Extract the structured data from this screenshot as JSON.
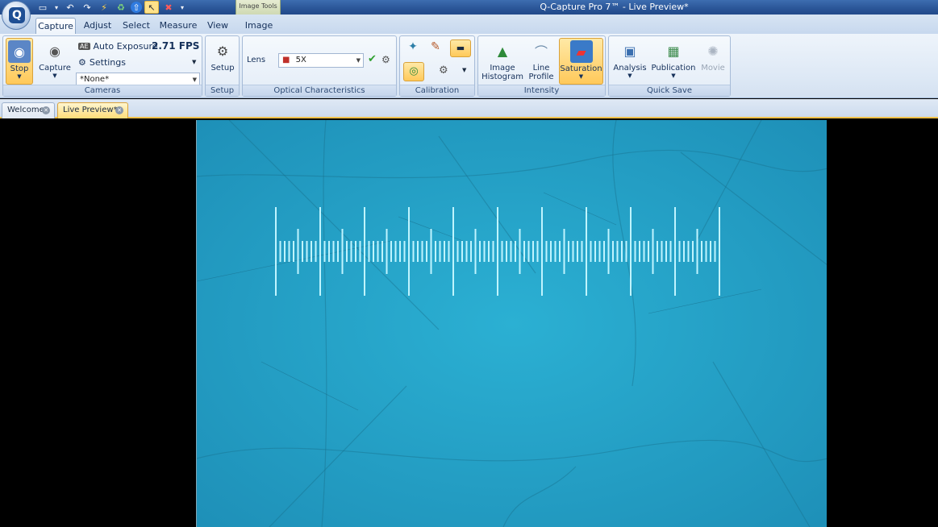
{
  "window": {
    "title": "Q-Capture Pro 7™ - Live Preview*",
    "contextual_tab": "Image Tools"
  },
  "quick_access": {
    "icons": [
      "save-icon",
      "dropdown-icon",
      "undo-icon",
      "redo-icon",
      "lightning-icon",
      "recycle-icon",
      "upload-icon",
      "pointer-icon",
      "stop-icon",
      "customize-icon"
    ]
  },
  "ribbon_tabs": [
    "Capture",
    "Adjust",
    "Select",
    "Measure",
    "View",
    "Image"
  ],
  "active_tab": "Capture",
  "cameras": {
    "stop_label": "Stop",
    "capture_label": "Capture",
    "auto_exposure_label": "Auto Exposure",
    "fps": "2.71 FPS",
    "settings_label": "Settings",
    "preset_value": "*None*",
    "group_label": "Cameras"
  },
  "setup": {
    "button_label": "Setup",
    "group_label": "Setup"
  },
  "optical": {
    "lens_label": "Lens",
    "lens_value": "5X",
    "group_label": "Optical Characteristics"
  },
  "calibration": {
    "group_label": "Calibration"
  },
  "intensity": {
    "histogram_label_1": "Image",
    "histogram_label_2": "Histogram",
    "profile_label_1": "Line",
    "profile_label_2": "Profile",
    "saturation_label": "Saturation",
    "group_label": "Intensity"
  },
  "quick_save": {
    "analysis_label": "Analysis",
    "publication_label": "Publication",
    "movie_label": "Movie",
    "group_label": "Quick Save"
  },
  "doc_tabs": [
    {
      "label": "Welcome",
      "active": false
    },
    {
      "label": "Live Preview*",
      "active": true
    }
  ],
  "colors": {
    "accent": "#ffc95a",
    "titlebar": "#2a5597",
    "preview_bg": "#24a4c8",
    "scale": "#bff4ff"
  }
}
